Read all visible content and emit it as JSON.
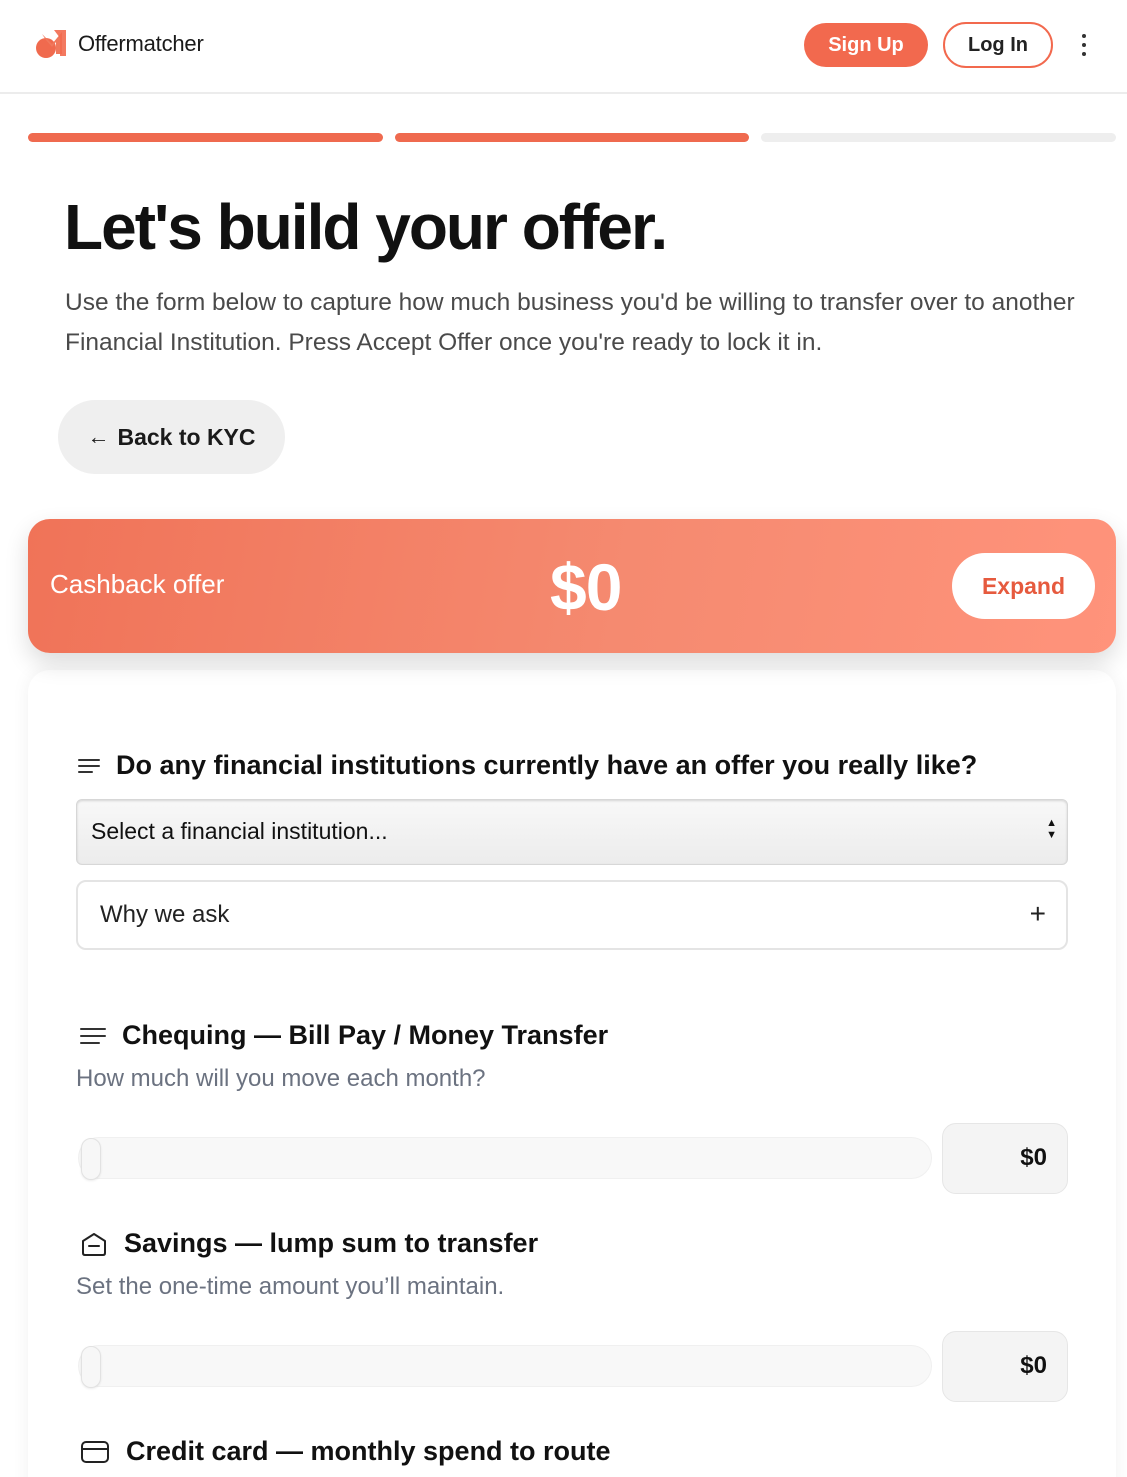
{
  "header": {
    "brand": "Offermatcher",
    "signup_label": "Sign Up",
    "login_label": "Log In"
  },
  "progress": {
    "steps_total": 3,
    "steps_completed": 2
  },
  "page": {
    "title": "Let's build your offer.",
    "subtitle": "Use the form below to capture how much business you'd be willing to transfer over to another Financial Institution. Press Accept Offer once you're ready to lock it in.",
    "back_label": "Back to KYC"
  },
  "cashback": {
    "label": "Cashback offer",
    "amount": "$0",
    "expand_label": "Expand"
  },
  "questions": {
    "institution": {
      "heading": "Do any financial institutions currently have an offer you really like?",
      "select_value": "Select a financial institution...",
      "why_label": "Why we ask",
      "why_toggle": "+"
    },
    "chequing": {
      "heading": "Chequing — Bill Pay / Money Transfer",
      "sub": "How much will you move each month?",
      "value": "$0",
      "slider_fraction": 0
    },
    "savings": {
      "heading": "Savings — lump sum to transfer",
      "sub": "Set the one-time amount you’ll maintain.",
      "value": "$0",
      "slider_fraction": 0
    },
    "credit": {
      "heading": "Credit card — monthly spend to route"
    }
  },
  "colors": {
    "accent": "#f2694e",
    "progress_done": "#ef6a4f",
    "progress_todo": "#eeeeee"
  }
}
